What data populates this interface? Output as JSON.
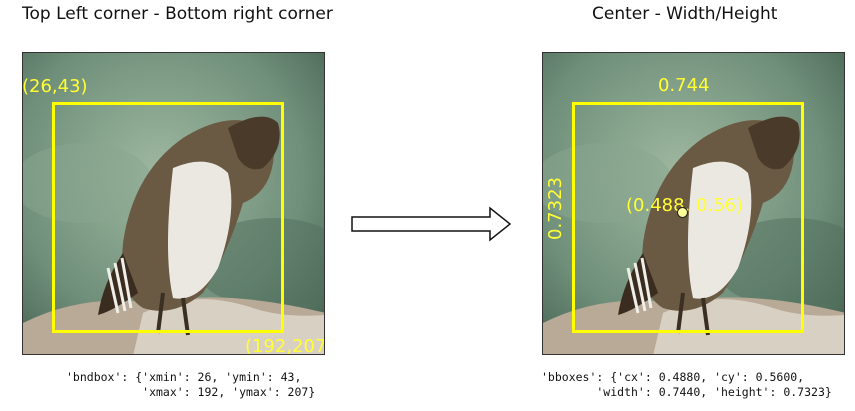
{
  "left": {
    "title": "Top Left corner - Bottom right corner",
    "top_left_label": "(26,43)",
    "bottom_right_label": "(192,207",
    "code_line1": "'bndbox': {'xmin': 26, 'ymin': 43,",
    "code_line2": "           'xmax': 192, 'ymax': 207}"
  },
  "right": {
    "title": "Center - Width/Height",
    "width_label": "0.744",
    "height_label": "0.7323",
    "center_label": "(0.488, 0.56)",
    "code_line1": "'bboxes': {'cx': 0.4880, 'cy': 0.5600,",
    "code_line2": "        'width': 0.7440, 'height': 0.7323}"
  },
  "colors": {
    "bbox": "#ffff00",
    "label": "#ffff33"
  },
  "icons": {
    "arrow": "right-arrow-icon",
    "photo": "bird-photo"
  }
}
